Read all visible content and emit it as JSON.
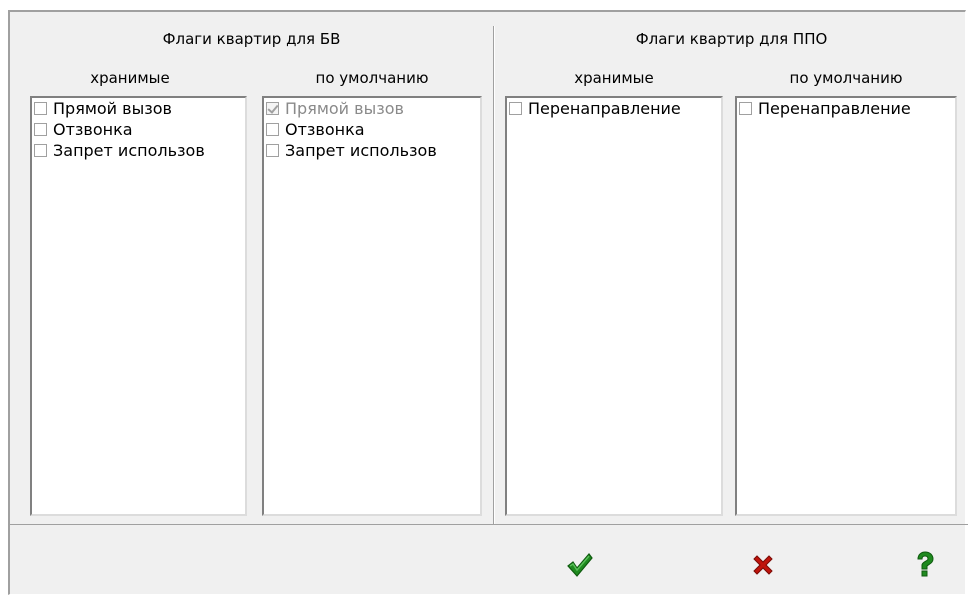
{
  "groups": {
    "bv": {
      "title": "Флаги квартир для БВ",
      "stored_label": "хранимые",
      "default_label": "по умолчанию",
      "stored_items": [
        {
          "label": "Прямой вызов",
          "checked": false,
          "disabled": false
        },
        {
          "label": "Отзвонка",
          "checked": false,
          "disabled": false
        },
        {
          "label": "Запрет использов",
          "checked": false,
          "disabled": false
        }
      ],
      "default_items": [
        {
          "label": "Прямой вызов",
          "checked": true,
          "disabled": true
        },
        {
          "label": "Отзвонка",
          "checked": false,
          "disabled": false
        },
        {
          "label": "Запрет использов",
          "checked": false,
          "disabled": false
        }
      ]
    },
    "ppo": {
      "title": "Флаги квартир для ППО",
      "stored_label": "хранимые",
      "default_label": "по умолчанию",
      "stored_items": [
        {
          "label": "Перенаправление",
          "checked": false,
          "disabled": false
        }
      ],
      "default_items": [
        {
          "label": "Перенаправление",
          "checked": false,
          "disabled": false
        }
      ]
    }
  },
  "buttons": {
    "ok_icon": "checkmark-icon",
    "cancel_icon": "cross-icon",
    "help_icon": "question-icon",
    "ok_color": "#1f8a1f",
    "cancel_color": "#c0140c",
    "help_color": "#1f8a1f"
  }
}
